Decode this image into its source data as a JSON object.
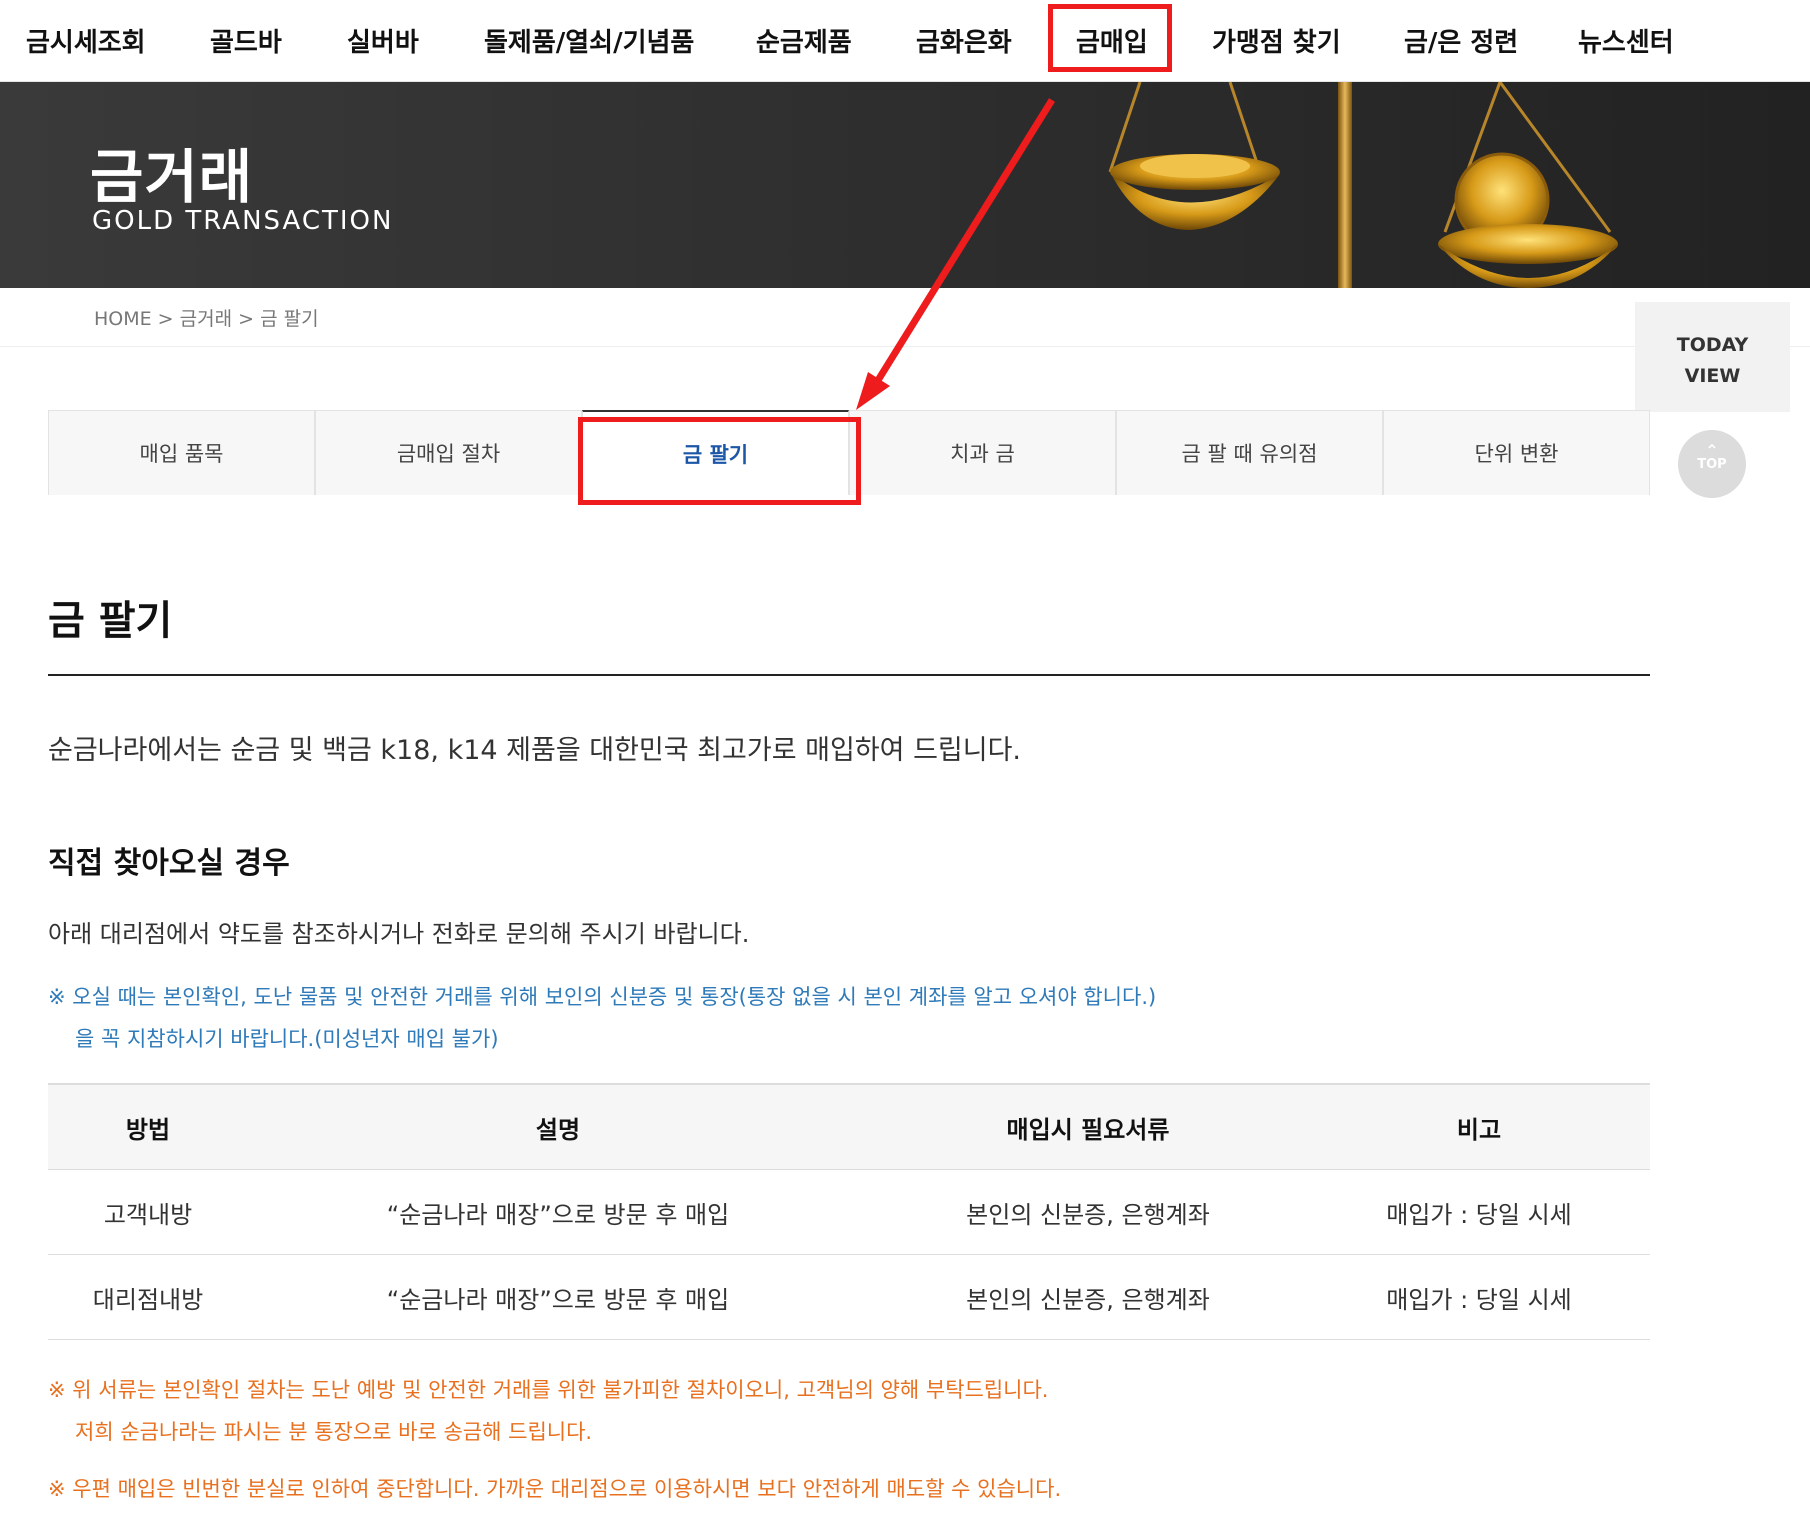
{
  "nav": {
    "items": [
      "금시세조회",
      "골드바",
      "실버바",
      "돌제품/열쇠/기념품",
      "순금제품",
      "금화은화",
      "금매입",
      "가맹점 찾기",
      "금/은 정련",
      "뉴스센터"
    ],
    "active": "금매입"
  },
  "banner": {
    "title": "금거래",
    "subtitle": "GOLD TRANSACTION"
  },
  "breadcrumb": "HOME > 금거래 > 금 팔기",
  "side": {
    "today_view_1": "TODAY",
    "today_view_2": "VIEW",
    "top_label": "TOP"
  },
  "tabs": [
    "매입 품목",
    "금매입 절차",
    "금 팔기",
    "치과 금",
    "금 팔 때 유의점",
    "단위 변환"
  ],
  "active_tab": "금 팔기",
  "content": {
    "title": "금 팔기",
    "intro": "순금나라에서는 순금 및 백금 k18, k14 제품을 대한민국 최고가로 매입하여 드립니다.",
    "visit_heading": "직접 찾아오실 경우",
    "visit_desc": "아래 대리점에서 약도를 참조하시거나 전화로 문의해 주시기 바랍니다.",
    "blue_note_1": "※ 오실 때는 본인확인, 도난 물품 및 안전한 거래를 위해 보인의 신분증 및 통장(통장 없을 시 본인 계좌를 알고 오셔야 합니다.)",
    "blue_note_2": "을 꼭 지참하시기 바랍니다.(미성년자 매입 불가)",
    "table": {
      "headers": [
        "방법",
        "설명",
        "매입시 필요서류",
        "비고"
      ],
      "rows": [
        [
          "고객내방",
          "“순금나라 매장”으로 방문 후 매입",
          "본인의 신분증, 은행계좌",
          "매입가 : 당일 시세"
        ],
        [
          "대리점내방",
          "“순금나라 매장”으로 방문 후 매입",
          "본인의 신분증, 은행계좌",
          "매입가 : 당일 시세"
        ]
      ]
    },
    "orange_note_1a": "※ 위 서류는 본인확인 절차는 도난 예방 및 안전한 거래를 위한 불가피한 절차이오니, 고객님의 양해 부탁드립니다.",
    "orange_note_1b": "저희 순금나라는 파시는 분 통장으로 바로 송금해 드립니다.",
    "orange_note_2": "※ 우편 매입은 빈번한 분실로 인하여 중단합니다. 가까운 대리점으로 이용하시면 보다 안전하게 매도할 수 있습니다."
  },
  "colors": {
    "highlight": "#ee1c1c",
    "active_tab": "#1b56a7",
    "blue_note": "#2f7ab9",
    "orange_note": "#e8701f"
  }
}
